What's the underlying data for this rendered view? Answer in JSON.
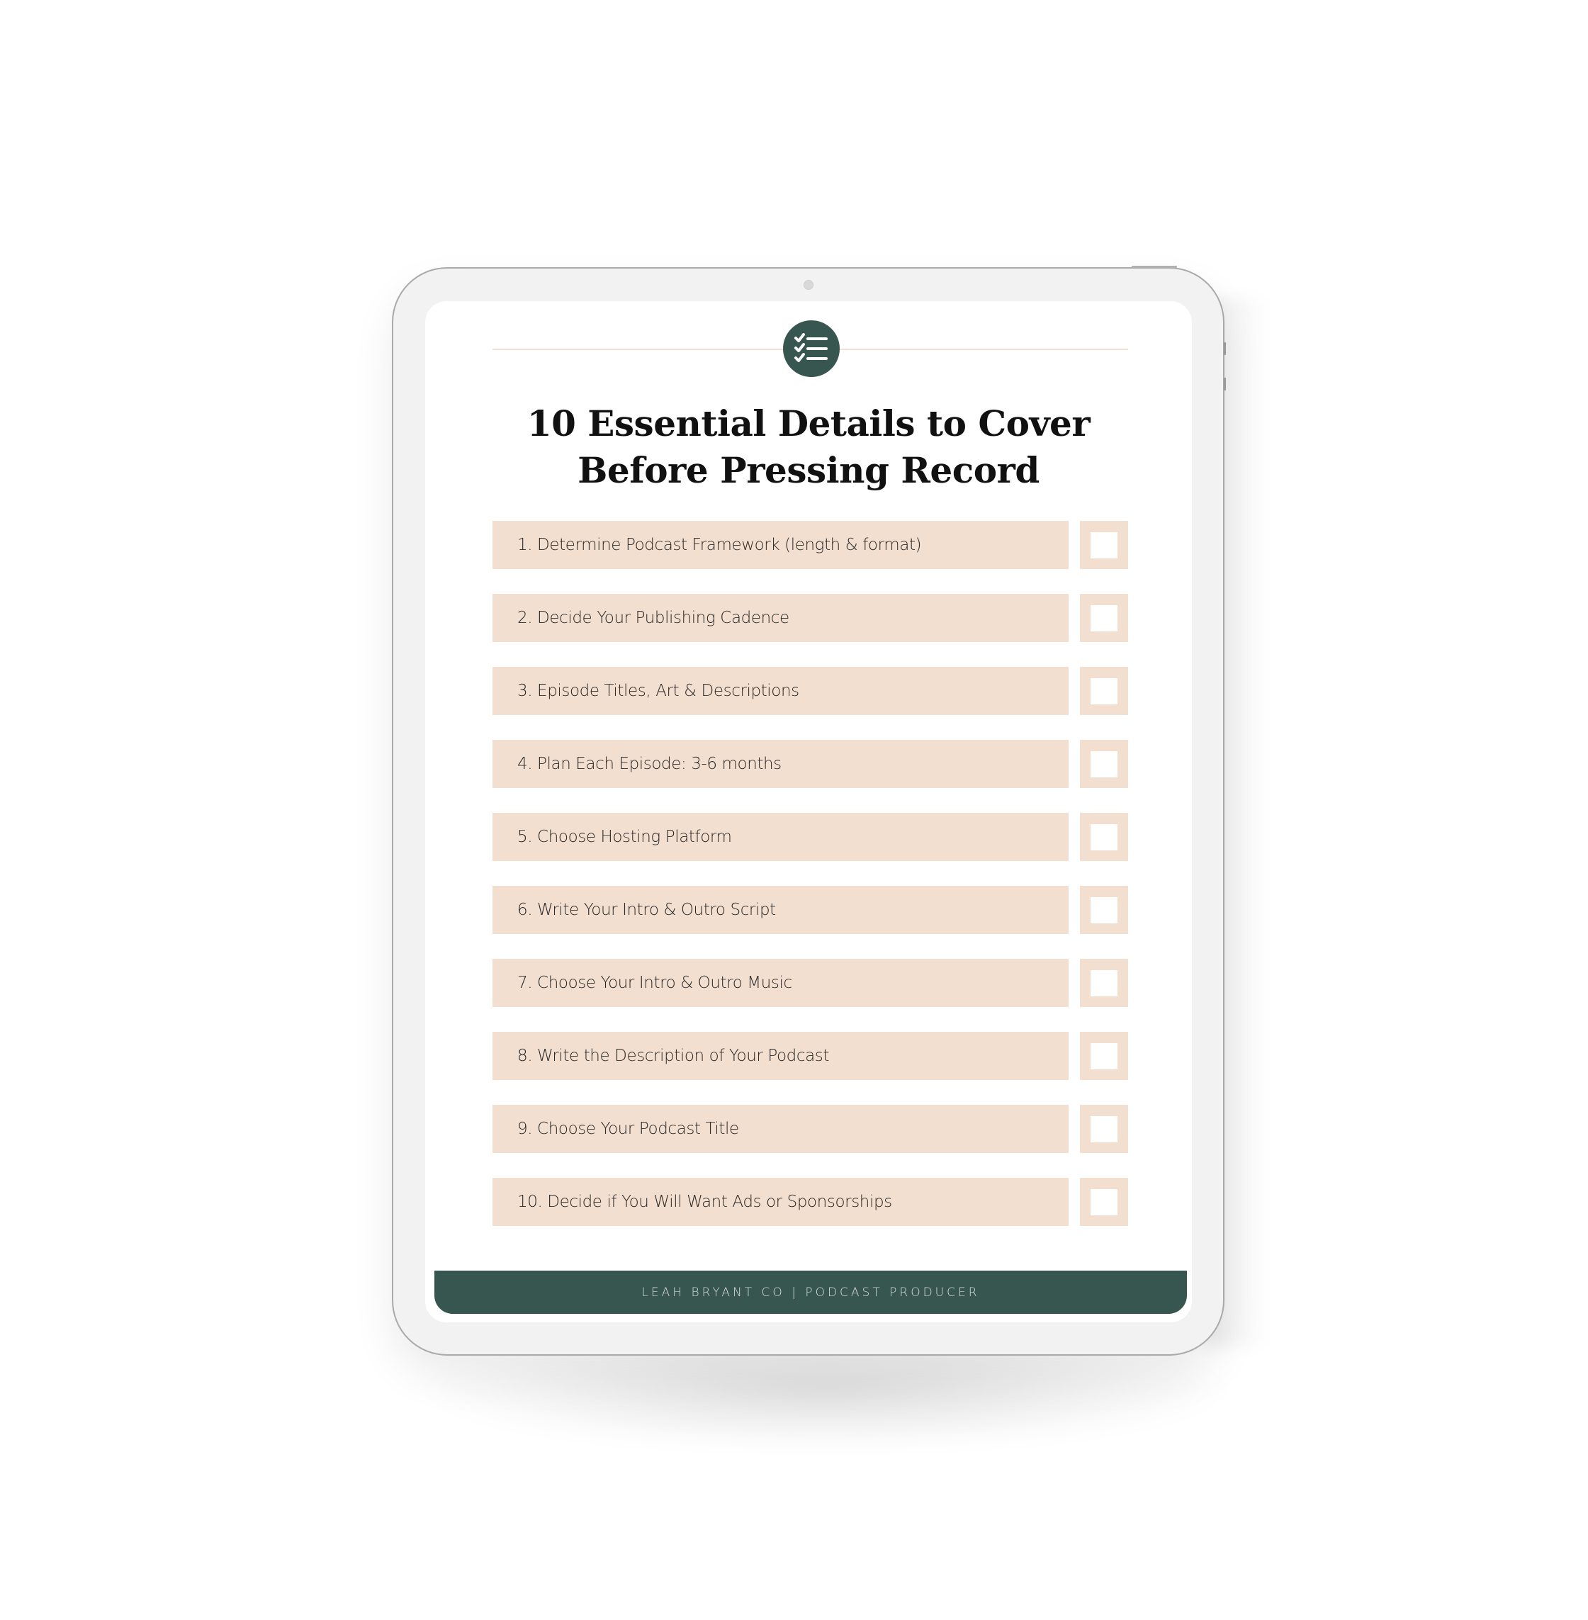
{
  "document": {
    "title": "10 Essential Details to Cover Before Pressing Record",
    "header_icon": "checklist-icon",
    "checklist": [
      {
        "label": "1. Determine Podcast Framework (length & format)",
        "checked": false
      },
      {
        "label": "2. Decide Your Publishing Cadence",
        "checked": false
      },
      {
        "label": "3. Episode Titles, Art & Descriptions",
        "checked": false
      },
      {
        "label": "4. Plan Each Episode: 3-6 months",
        "checked": false
      },
      {
        "label": "5. Choose Hosting Platform",
        "checked": false
      },
      {
        "label": "6. Write Your Intro & Outro Script",
        "checked": false
      },
      {
        "label": "7. Choose Your Intro & Outro Music",
        "checked": false
      },
      {
        "label": "8. Write the Description of Your Podcast",
        "checked": false
      },
      {
        "label": "9. Choose Your Podcast Title",
        "checked": false
      },
      {
        "label": "10. Decide if You Will Want Ads or Sponsorships",
        "checked": false
      }
    ],
    "footer": "LEAH BRYANT CO | PODCAST PRODUCER"
  },
  "colors": {
    "accent_green": "#37564f",
    "row_peach": "#f2dfd0",
    "device_frame": "#f2f2f2"
  }
}
